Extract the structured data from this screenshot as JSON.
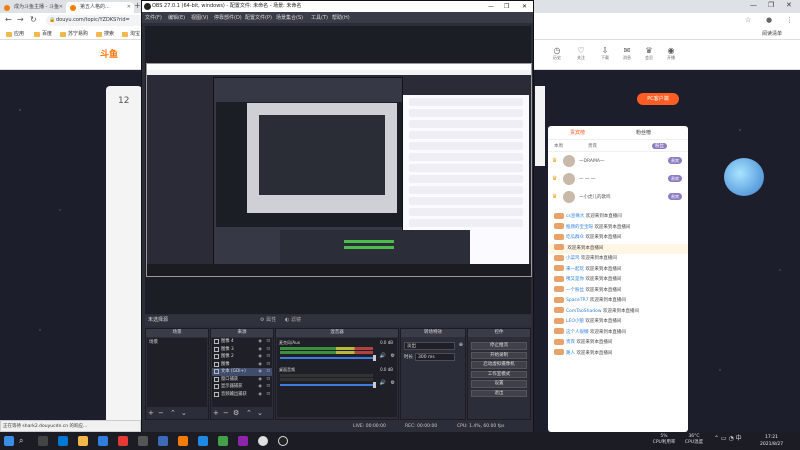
{
  "browser": {
    "tabs": [
      {
        "title": "成为斗鱼主播 - 斗鱼"
      },
      {
        "title": "第五人格的..."
      }
    ],
    "url": "douyu.com/topic/YZDKS?rid=",
    "bookmarks": [
      "应用",
      "百度",
      "苏宁易购",
      "搜索",
      "淘宝"
    ],
    "bookmarks_right": "阅读清单",
    "status_text": "正在等待 shark2.douyucdn.cn 的响应..."
  },
  "site": {
    "logo": "斗鱼",
    "left_card": {
      "count": "12"
    },
    "header_icons": [
      {
        "icon": "history-icon",
        "label": "历史"
      },
      {
        "icon": "follow-icon",
        "label": "关注"
      },
      {
        "icon": "download-icon",
        "label": "下载"
      },
      {
        "icon": "message-icon",
        "label": "消息"
      },
      {
        "icon": "vip-icon",
        "label": "会员"
      },
      {
        "icon": "broadcast-icon",
        "label": "开播"
      }
    ],
    "pc_button": "PC客户端",
    "chat": {
      "tabs": [
        "贵宾榜",
        "粉丝榜"
      ],
      "sub": [
        "本周",
        "贵宾",
        "粉丝"
      ],
      "ranks": [
        {
          "name": "一DRAMA一"
        },
        {
          "name": "一 一 一"
        },
        {
          "name": "一小虎儿的歌鸣"
        }
      ],
      "rank_tag": "贵宾",
      "messages": [
        {
          "user": "cs宣缘大",
          "text": "欢迎来到本直播间"
        },
        {
          "user": "瓶颈的宝宝呀",
          "text": "欢迎来到本直播间"
        },
        {
          "user": "吃瓜群众",
          "text": "欢迎来到本直播间"
        },
        {
          "user": "",
          "text": "欢迎来到本直播间",
          "sys": true
        },
        {
          "user": "小菜鸡",
          "text": "欢迎来到本直播间"
        },
        {
          "user": "来一起玩",
          "text": "欢迎来到本直播间"
        },
        {
          "user": "咦又是你",
          "text": "欢迎来到本直播间"
        },
        {
          "user": "一个粉丝",
          "text": "欢迎来到本直播间"
        },
        {
          "user": "SpaceTR7",
          "text": "欢迎来到本直播间"
        },
        {
          "user": "ComTaoShadow",
          "text": "欢迎来到本直播间"
        },
        {
          "user": "LEO小狼",
          "text": "欢迎来到本直播间"
        },
        {
          "user": "这个人很懒",
          "text": "欢迎来到本直播间"
        },
        {
          "user": "贵宾",
          "text": "欢迎来到本直播间"
        },
        {
          "user": "路人",
          "text": "欢迎来到本直播间"
        }
      ]
    }
  },
  "obs": {
    "title": "OBS 27.0.1 (64-bit, windows) - 配置文件: 未命名 - 场景: 未命名",
    "menu": [
      "文件(F)",
      "编辑(E)",
      "视图(V)",
      "停靠部件(D)",
      "配置文件(P)",
      "场景集合(S)",
      "工具(T)",
      "帮助(H)"
    ],
    "scene_bar": {
      "label": "未选择源",
      "props": "属性",
      "filters": "滤镜"
    },
    "docks": {
      "scenes": {
        "title": "场景",
        "items": [
          "场景"
        ]
      },
      "sources": {
        "title": "来源",
        "items": [
          "图像 4",
          "图像 3",
          "图像 2",
          "图像",
          "文本 (GDI+)",
          "窗口捕获",
          "显示器捕获",
          "音频输出捕获"
        ]
      },
      "mixer": {
        "title": "混音器",
        "channels": [
          {
            "name": "麦克风/Aux",
            "db": "0.0 dB"
          },
          {
            "name": "桌面音频",
            "db": "0.0 dB"
          }
        ]
      },
      "transitions": {
        "title": "转场特效",
        "type": "淡出",
        "duration_label": "时长",
        "duration": "300 ms"
      },
      "controls": {
        "title": "控件",
        "buttons": [
          "停止推流",
          "开始录制",
          "启动虚拟摄像机",
          "工作室模式",
          "设置",
          "退出"
        ]
      }
    },
    "status": {
      "live": "LIVE: 00:00:00",
      "rec": "REC: 00:00:00",
      "cpu": "CPU: 1.4%, 60.00 fps"
    }
  },
  "taskbar": {
    "cpu_temp": "5%",
    "cpu_label": "CPU利用率",
    "temp": "36°C",
    "temp_label": "CPU温度",
    "time": "17:21",
    "date": "2021/8/27"
  }
}
